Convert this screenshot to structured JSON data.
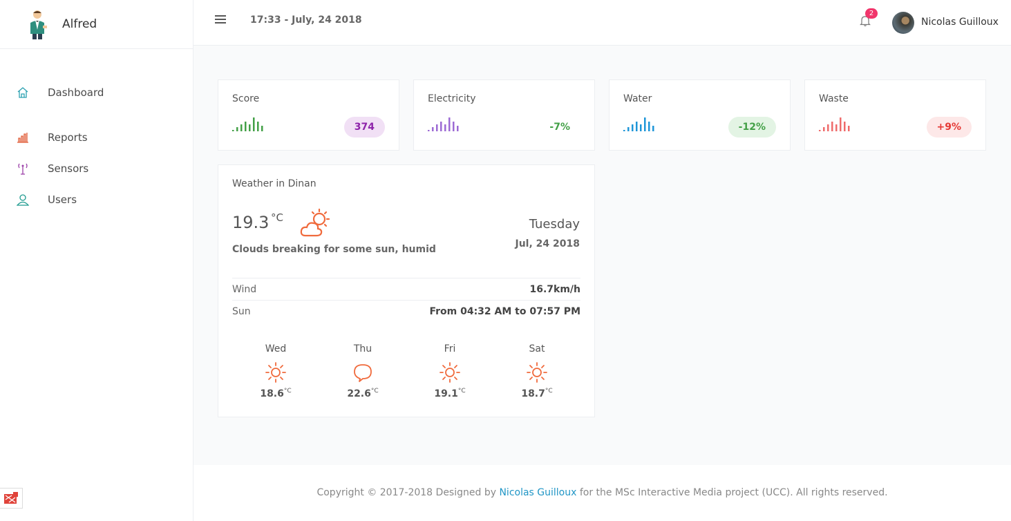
{
  "app": {
    "name": "Alfred"
  },
  "sidebar": {
    "items": [
      {
        "label": "Dashboard",
        "icon": "home-icon",
        "color": "#2aa0b0"
      },
      {
        "label": "Reports",
        "icon": "bar-chart-icon",
        "color": "#e05a35"
      },
      {
        "label": "Sensors",
        "icon": "antenna-icon",
        "color": "#9b3fa8"
      },
      {
        "label": "Users",
        "icon": "user-icon",
        "color": "#1f9b8f"
      }
    ]
  },
  "header": {
    "datetime": "17:33 - July, 24 2018",
    "notifications_count": "2",
    "user_name": "Nicolas Guilloux"
  },
  "stats": [
    {
      "title": "Score",
      "value": "374",
      "color": "#8e24aa",
      "pill_bg": "#f1e0f5",
      "spark_color": "#43a047"
    },
    {
      "title": "Electricity",
      "value": "-7%",
      "color": "#43a047",
      "pill_bg": "transparent",
      "spark_color": "#9c6ad4"
    },
    {
      "title": "Water",
      "value": "-12%",
      "color": "#43a047",
      "pill_bg": "#e3f4e4",
      "spark_color": "#1e96d8"
    },
    {
      "title": "Waste",
      "value": "+9%",
      "color": "#e53935",
      "pill_bg": "#fde8e8",
      "spark_color": "#ef6b6b"
    }
  ],
  "weather": {
    "title": "Weather in Dinan",
    "temp": "19.3",
    "unit": "°C",
    "icon": "partly-cloudy-icon",
    "description": "Clouds breaking for some sun, humid",
    "day": "Tuesday",
    "date": "Jul, 24 2018",
    "wind_label": "Wind",
    "wind_value": "16.7km/h",
    "sun_label": "Sun",
    "sun_value": "From 04:32 AM to 07:57 PM",
    "forecast": [
      {
        "day": "Wed",
        "temp": "18.6",
        "unit": "°C",
        "icon": "sun-icon"
      },
      {
        "day": "Thu",
        "temp": "22.6",
        "unit": "°C",
        "icon": "cloud-icon"
      },
      {
        "day": "Fri",
        "temp": "19.1",
        "unit": "°C",
        "icon": "sun-icon"
      },
      {
        "day": "Sat",
        "temp": "18.7",
        "unit": "°C",
        "icon": "sun-icon"
      }
    ]
  },
  "footer": {
    "prefix": "Copyright © 2017-2018 Designed by ",
    "author": "Nicolas Guilloux",
    "suffix": " for the MSc Interactive Media project (UCC). All rights reserved."
  }
}
